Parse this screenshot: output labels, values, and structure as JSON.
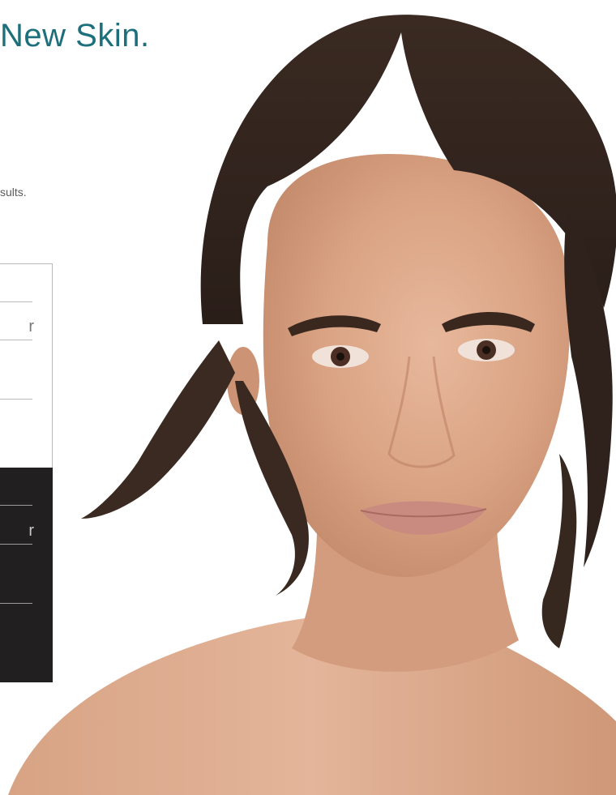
{
  "hero": {
    "headline": "New Skin.",
    "subtext": "sults.",
    "image_alt": "Portrait of a woman with dark hair pulled back and bare shoulders"
  },
  "pricing_light": {
    "rows": [
      {
        "label": ""
      },
      {
        "label": "r"
      },
      {
        "label": ""
      }
    ]
  },
  "pricing_dark": {
    "rows": [
      {
        "label": ""
      },
      {
        "label": "r"
      },
      {
        "label": ""
      }
    ]
  },
  "colors": {
    "accent": "#1d6f7c",
    "dark_card": "#221f20",
    "background": "#ffffff"
  }
}
